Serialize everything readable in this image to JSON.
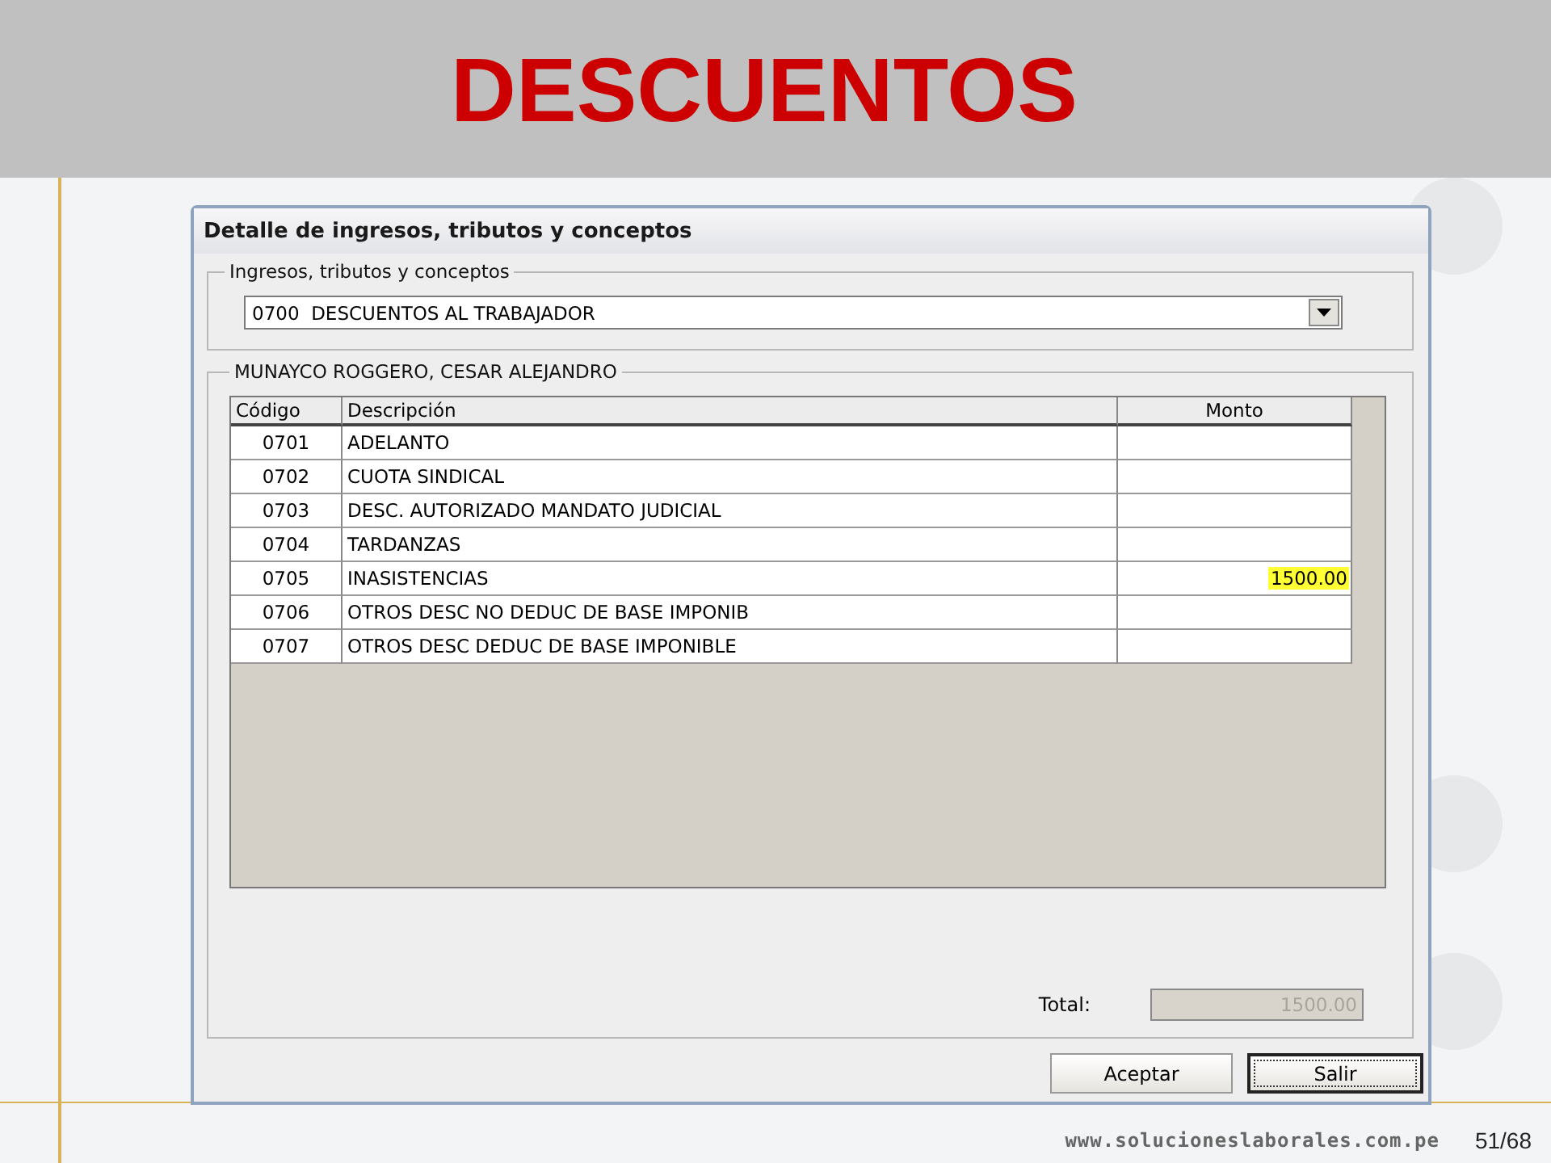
{
  "slide": {
    "title": "DESCUENTOS",
    "footer_url": "www.solucioneslaborales.com.pe",
    "page": "51/68"
  },
  "window": {
    "title": "Detalle de ingresos, tributos y conceptos"
  },
  "concept_group": {
    "label": "Ingresos, tributos y conceptos",
    "value": "0700  DESCUENTOS AL TRABAJADOR"
  },
  "employee_group": {
    "label": "MUNAYCO ROGGERO, CESAR ALEJANDRO"
  },
  "table": {
    "columns": [
      "Código",
      "Descripción",
      "Monto"
    ],
    "rows": [
      {
        "code": "0701",
        "description": "ADELANTO",
        "amount": "",
        "highlighted": false
      },
      {
        "code": "0702",
        "description": "CUOTA SINDICAL",
        "amount": "",
        "highlighted": false
      },
      {
        "code": "0703",
        "description": "DESC. AUTORIZADO MANDATO JUDICIAL",
        "amount": "",
        "highlighted": false
      },
      {
        "code": "0704",
        "description": "TARDANZAS",
        "amount": "",
        "highlighted": false
      },
      {
        "code": "0705",
        "description": "INASISTENCIAS",
        "amount": "1500.00",
        "highlighted": true
      },
      {
        "code": "0706",
        "description": "OTROS DESC NO DEDUC DE BASE IMPONIB",
        "amount": "",
        "highlighted": false
      },
      {
        "code": "0707",
        "description": "OTROS DESC DEDUC DE BASE IMPONIBLE",
        "amount": "",
        "highlighted": false
      }
    ]
  },
  "total": {
    "label": "Total:",
    "value": "1500.00",
    "disabled": true
  },
  "buttons": [
    {
      "label": "Aceptar",
      "default": false
    },
    {
      "label": "Salir",
      "default": true
    }
  ]
}
